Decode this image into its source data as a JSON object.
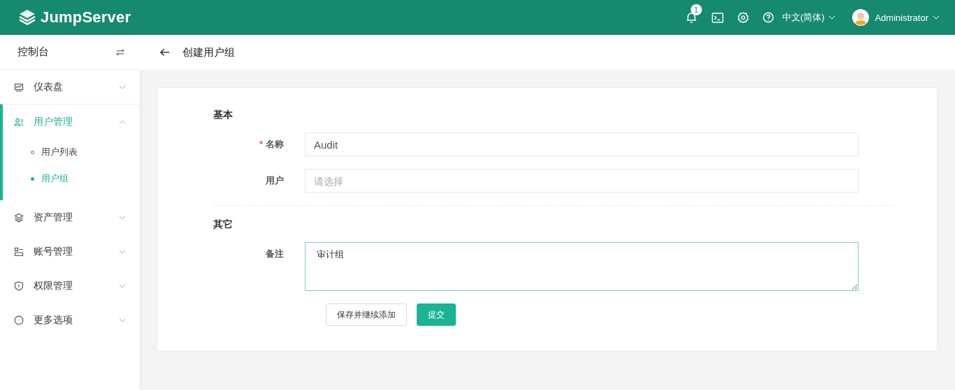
{
  "header": {
    "logo_text": "JumpServer",
    "notification_count": "1",
    "language": "中文(简体)",
    "user_name": "Administrator"
  },
  "sidebar": {
    "title": "控制台",
    "items": [
      {
        "label": "仪表盘",
        "kind": "dashboard",
        "selected": false,
        "expanded": false
      },
      {
        "label": "用户管理",
        "kind": "users",
        "selected": true,
        "expanded": true,
        "children": [
          {
            "label": "用户列表",
            "selected": false
          },
          {
            "label": "用户组",
            "selected": true
          }
        ]
      },
      {
        "label": "资产管理",
        "kind": "layers",
        "selected": false,
        "expanded": false
      },
      {
        "label": "账号管理",
        "kind": "accounts",
        "selected": false,
        "expanded": false
      },
      {
        "label": "权限管理",
        "kind": "shield",
        "selected": false,
        "expanded": false
      },
      {
        "label": "更多选项",
        "kind": "more",
        "selected": false,
        "expanded": false
      }
    ]
  },
  "page": {
    "title": "创建用户组"
  },
  "sections": [
    {
      "title": "基本",
      "fields": [
        {
          "kind": "input",
          "label": "名称",
          "required_mark": "*",
          "value": "Audit",
          "focused": false
        },
        {
          "kind": "select",
          "label": "用户",
          "placeholder": "请选择",
          "focused": false
        }
      ]
    },
    {
      "title": "其它",
      "fields": [
        {
          "kind": "textarea",
          "label": "备注",
          "value": "审计组",
          "focused": true
        }
      ]
    }
  ],
  "buttons": [
    {
      "label": "保存并继续添加",
      "kind": "default"
    },
    {
      "label": "提交",
      "kind": "primary"
    }
  ]
}
